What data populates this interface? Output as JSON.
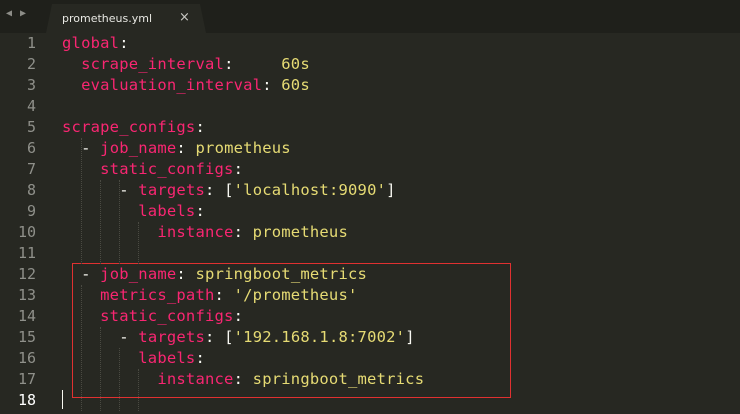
{
  "tab": {
    "title": "prometheus.yml",
    "close_icon": "×",
    "nav_left_icon": "◀",
    "nav_right_icon": "▶"
  },
  "gutter": [
    "1",
    "2",
    "3",
    "4",
    "5",
    "6",
    "7",
    "8",
    "9",
    "10",
    "11",
    "12",
    "13",
    "14",
    "15",
    "16",
    "17",
    "18"
  ],
  "current_line": 18,
  "highlight_color": "#e03131",
  "syntax_colors": {
    "key": "#f92672",
    "string": "#e6db74",
    "punct": "#f8f8f2",
    "background": "#272822"
  },
  "lines": [
    [
      [
        "k",
        "global"
      ],
      [
        "p",
        ":"
      ]
    ],
    [
      [
        "p",
        "  "
      ],
      [
        "k",
        "scrape_interval"
      ],
      [
        "p",
        ":     "
      ],
      [
        "n",
        "60s"
      ]
    ],
    [
      [
        "p",
        "  "
      ],
      [
        "k",
        "evaluation_interval"
      ],
      [
        "p",
        ": "
      ],
      [
        "n",
        "60s"
      ]
    ],
    [],
    [
      [
        "k",
        "scrape_configs"
      ],
      [
        "p",
        ":"
      ]
    ],
    [
      [
        "p",
        "  "
      ],
      [
        "p",
        "- "
      ],
      [
        "k",
        "job_name"
      ],
      [
        "p",
        ": "
      ],
      [
        "s",
        "prometheus"
      ]
    ],
    [
      [
        "p",
        "    "
      ],
      [
        "k",
        "static_configs"
      ],
      [
        "p",
        ":"
      ]
    ],
    [
      [
        "p",
        "      "
      ],
      [
        "p",
        "- "
      ],
      [
        "k",
        "targets"
      ],
      [
        "p",
        ": ["
      ],
      [
        "s",
        "'localhost:9090'"
      ],
      [
        "p",
        "]"
      ]
    ],
    [
      [
        "p",
        "        "
      ],
      [
        "k",
        "labels"
      ],
      [
        "p",
        ":"
      ]
    ],
    [
      [
        "p",
        "          "
      ],
      [
        "k",
        "instance"
      ],
      [
        "p",
        ": "
      ],
      [
        "s",
        "prometheus"
      ]
    ],
    [],
    [
      [
        "p",
        "  "
      ],
      [
        "p",
        "- "
      ],
      [
        "k",
        "job_name"
      ],
      [
        "p",
        ": "
      ],
      [
        "s",
        "springboot_metrics"
      ]
    ],
    [
      [
        "p",
        "    "
      ],
      [
        "k",
        "metrics_path"
      ],
      [
        "p",
        ": "
      ],
      [
        "s",
        "'/prometheus'"
      ]
    ],
    [
      [
        "p",
        "    "
      ],
      [
        "k",
        "static_configs"
      ],
      [
        "p",
        ":"
      ]
    ],
    [
      [
        "p",
        "      "
      ],
      [
        "p",
        "- "
      ],
      [
        "k",
        "targets"
      ],
      [
        "p",
        ": ["
      ],
      [
        "s",
        "'192.168.1.8:7002'"
      ],
      [
        "p",
        "]"
      ]
    ],
    [
      [
        "p",
        "        "
      ],
      [
        "k",
        "labels"
      ],
      [
        "p",
        ":"
      ]
    ],
    [
      [
        "p",
        "          "
      ],
      [
        "k",
        "instance"
      ],
      [
        "p",
        ": "
      ],
      [
        "s",
        "springboot_metrics"
      ]
    ],
    []
  ]
}
